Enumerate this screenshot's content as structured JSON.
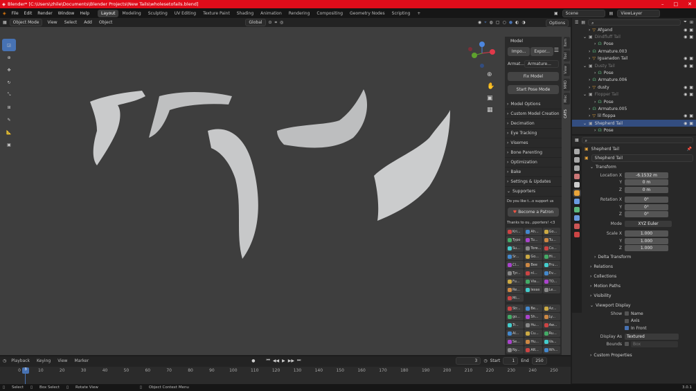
{
  "titlebar": {
    "title": "Blender* [C:\\Users\\zhile\\Documents\\Blender Projects\\New Tails\\wholesetofails.blend]",
    "min": "–",
    "max": "□",
    "close": "✕"
  },
  "menu": {
    "items": [
      "File",
      "Edit",
      "Render",
      "Window",
      "Help"
    ]
  },
  "workspaces": [
    "Layout",
    "Modeling",
    "Sculpting",
    "UV Editing",
    "Texture Paint",
    "Shading",
    "Animation",
    "Rendering",
    "Compositing",
    "Geometry Nodes",
    "Scripting"
  ],
  "workspace_add": "+",
  "scene": {
    "label": "Scene",
    "view_layer": "ViewLayer"
  },
  "header": {
    "mode": "Object Mode",
    "menus": [
      "View",
      "Select",
      "Add",
      "Object"
    ],
    "orientation": "Global",
    "options": "Options"
  },
  "npanel": {
    "title": "Model",
    "import": "Impo...",
    "export": "Expor...",
    "armature_label": "Armat...",
    "armature_value": "Armature...",
    "fix_model": "Fix Model",
    "start_pose": "Start Pose Mode",
    "sections": [
      "Model Options",
      "Custom Model Creation",
      "Decimation",
      "Eye Tracking",
      "Visemes",
      "Bone Parenting",
      "Optimization",
      "Bake",
      "Settings & Updates"
    ],
    "supporters": "Supporters",
    "support_text": "Do you like t...o support us",
    "patron": "Become a Patron",
    "thanks": "Thanks to ou...pporters! <3",
    "grid1": [
      "Kri...",
      "Ah...",
      "Go...",
      "Typo",
      "Tu...",
      "Tu...",
      "Su...",
      "Tore...",
      "Co...",
      "Sr...",
      "Go...",
      "Hi...",
      "Cl...",
      "Bee",
      "Fru...",
      "Tyr...",
      "nl...",
      "Ev...",
      "Fu...",
      "Via...",
      "TO...",
      "Re...",
      "lexas",
      "Le...",
      "Mi..."
    ],
    "grid2": [
      "Str...",
      "Be...",
      "Az...",
      "go...",
      "Sh...",
      "Ly...",
      "Tr...",
      "Hu...",
      "Aw...",
      "Al...",
      "Cu...",
      "Ru...",
      "Se...",
      "Hu...",
      "Va...",
      "Ny...",
      "AR...",
      "Wh..."
    ],
    "tabs": [
      "Item",
      "Tool",
      "View",
      "MMD",
      "Misc",
      "CATS"
    ]
  },
  "outliner": {
    "search_placeholder": "",
    "rows": [
      {
        "name": "Afgand",
        "indent": 2,
        "kind": "mesh"
      },
      {
        "name": "Dindfluff Tail",
        "indent": 1,
        "kind": "collection"
      },
      {
        "name": "Pose",
        "indent": 3,
        "kind": "pose"
      },
      {
        "name": "Armature.003",
        "indent": 2,
        "kind": "armature"
      },
      {
        "name": "Iguanadon Tail",
        "indent": 2,
        "kind": "mesh"
      },
      {
        "name": "Dusty Tail",
        "indent": 1,
        "kind": "collection"
      },
      {
        "name": "Pose",
        "indent": 3,
        "kind": "pose"
      },
      {
        "name": "Armature.006",
        "indent": 2,
        "kind": "armature"
      },
      {
        "name": "dusty",
        "indent": 2,
        "kind": "mesh"
      },
      {
        "name": "Flopper Tail",
        "indent": 1,
        "kind": "collection"
      },
      {
        "name": "Pose",
        "indent": 3,
        "kind": "pose"
      },
      {
        "name": "Armature.005",
        "indent": 2,
        "kind": "armature"
      },
      {
        "name": "lil floppa",
        "indent": 2,
        "kind": "mesh"
      },
      {
        "name": "Shepherd Tail",
        "indent": 1,
        "kind": "collection",
        "selected": true
      },
      {
        "name": "Pose",
        "indent": 3,
        "kind": "pose"
      }
    ]
  },
  "properties": {
    "object_name": "Shepherd Tail",
    "object_name2": "Shepherd Tail",
    "transform": "Transform",
    "location": {
      "label": "Location X",
      "x": "-6.1532 m",
      "y": "0 m",
      "z": "0 m"
    },
    "rotation": {
      "label": "Rotation X",
      "x": "0°",
      "y": "0°",
      "z": "0°"
    },
    "mode_label": "Mode",
    "mode": "XYZ Euler",
    "scale": {
      "label": "Scale X",
      "x": "1.000",
      "y": "1.000",
      "z": "1.000"
    },
    "y_label": "Y",
    "z_label": "Z",
    "sections": [
      "Delta Transform",
      "Relations",
      "Collections",
      "Motion Paths",
      "Visibility"
    ],
    "viewport_display": "Viewport Display",
    "show_label": "Show",
    "show_name": "Name",
    "show_axis": "Axis",
    "show_infront": "In Front",
    "display_as_label": "Display As",
    "display_as": "Textured",
    "bounds_label": "Bounds",
    "bounds": "Box",
    "custom_props": "Custom Properties"
  },
  "timeline": {
    "menus": [
      "Playback",
      "Keying",
      "View",
      "Marker"
    ],
    "current_frame": "3",
    "start_label": "Start",
    "start": "1",
    "end_label": "End",
    "end": "250",
    "ticks": [
      "0",
      "10",
      "20",
      "30",
      "40",
      "50",
      "60",
      "70",
      "80",
      "90",
      "100",
      "110",
      "120",
      "130",
      "140",
      "150",
      "160",
      "170",
      "180",
      "190",
      "200",
      "210",
      "220",
      "230",
      "240",
      "250"
    ]
  },
  "status": {
    "select": "Select",
    "box_select": "Box Select",
    "rotate_view": "Rotate View",
    "context_menu": "Object Context Menu",
    "version": "3.0.1"
  },
  "colors": {
    "accent": "#4772b3",
    "titlebar": "#e00c1a",
    "selected": "#334d80"
  }
}
